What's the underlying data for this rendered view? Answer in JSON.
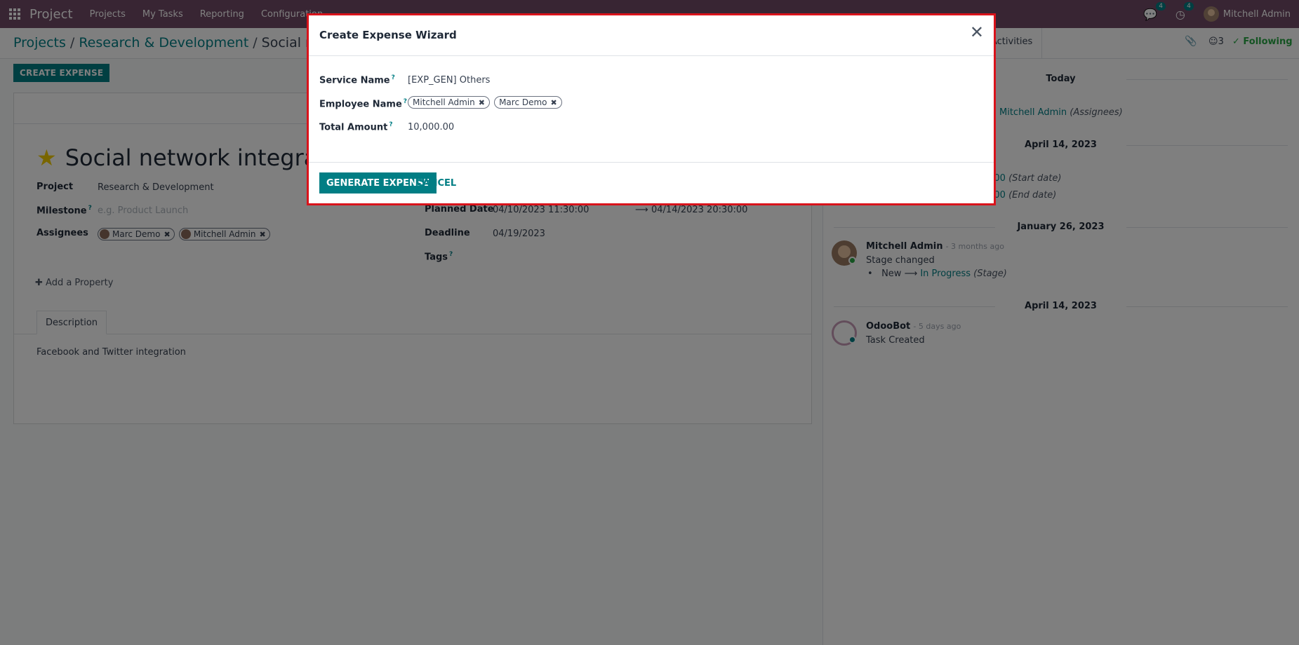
{
  "navbar": {
    "brand": "Project",
    "menu": [
      "Projects",
      "My Tasks",
      "Reporting",
      "Configuration"
    ],
    "messages_count": "4",
    "activities_count": "4",
    "user": "Mitchell Admin"
  },
  "breadcrumb": {
    "items": [
      "Projects",
      "Research & Development"
    ],
    "current": "Social networ"
  },
  "control": {
    "activities": "Activities",
    "followers": "3",
    "following": "Following"
  },
  "actions": {
    "create_expense": "CREATE EXPENSE"
  },
  "task": {
    "title": "Social network integratio",
    "project_label": "Project",
    "project": "Research & Development",
    "milestone_label": "Milestone",
    "milestone_placeholder": "e.g. Product Launch",
    "assignees_label": "Assignees",
    "assignees": [
      "Marc Demo",
      "Mitchell Admin"
    ],
    "planned_label": "Planned Date",
    "planned_start": "04/10/2023 11:30:00",
    "planned_end": "04/14/2023 20:30:00",
    "deadline_label": "Deadline",
    "deadline": "04/19/2023",
    "tags_label": "Tags",
    "add_property": "Add a Property",
    "tab_description": "Description",
    "description": "Facebook and Twitter integration"
  },
  "chatter": {
    "today": "Today",
    "today_assignee": "Mitchell Admin",
    "today_assignee_note": "(Assignees)",
    "date1": "April 14, 2023",
    "start_time": ":00",
    "start_note": "(Start date)",
    "end_time": ":00",
    "end_note": "(End date)",
    "date2": "January 26, 2023",
    "msg1_author": "Mitchell Admin",
    "msg1_ago": "- 3 months ago",
    "msg1_body": "Stage changed",
    "msg1_old": "New",
    "msg1_new": "In Progress",
    "msg1_field": "(Stage)",
    "date3": "April 14, 2023",
    "msg2_author": "OdooBot",
    "msg2_ago": "- 5 days ago",
    "msg2_body": "Task Created"
  },
  "modal": {
    "title": "Create Expense Wizard",
    "service_label": "Service Name",
    "service_value": "[EXP_GEN] Others",
    "employee_label": "Employee Name",
    "employees": [
      "Mitchell Admin",
      "Marc Demo"
    ],
    "amount_label": "Total Amount",
    "amount_value": "10,000.00",
    "generate": "GENERATE EXPENSE",
    "cancel": "CANCEL"
  },
  "colors": {
    "navbar": "#714B67",
    "primary": "#017e84",
    "modal_border": "#d9131b",
    "star": "#f3cc00"
  }
}
